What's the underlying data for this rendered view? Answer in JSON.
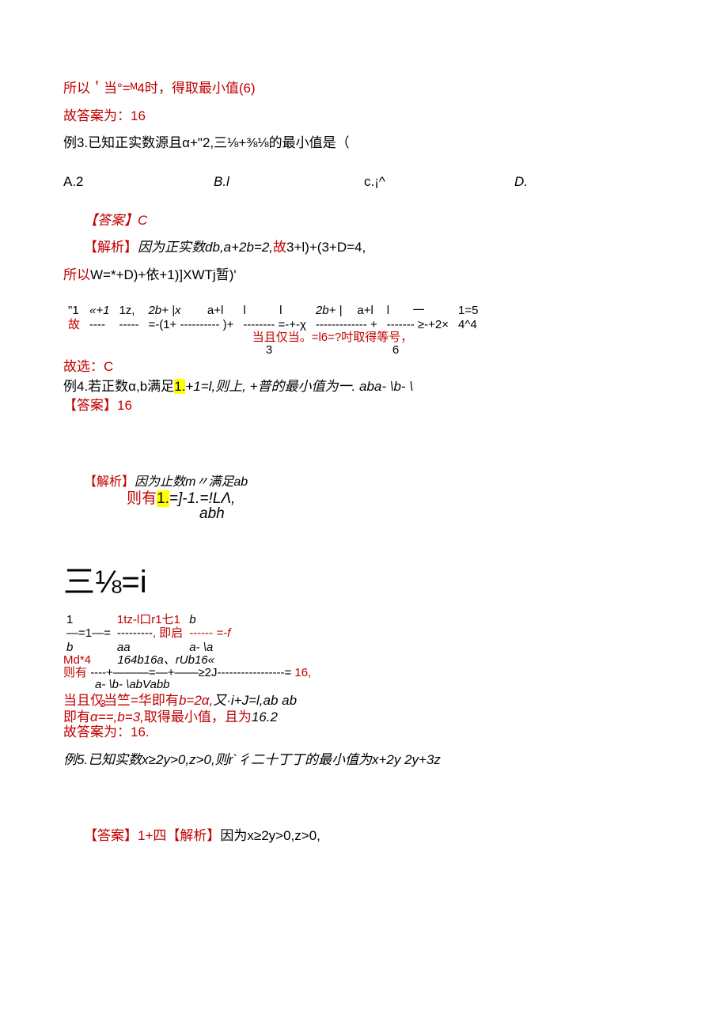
{
  "l1": "所以＇当°=ᴹ4时，得",
  "l1b": "取最小值(6)",
  "l2": "故答案为：16",
  "l3": "例3.已知正实数源且α+\"2,三⅛+⅜⅛的最小值是（",
  "choices": {
    "a": "A.2",
    "b": "B.l",
    "c": "c.¡^",
    "d": "D."
  },
  "ans1": "【答案】C",
  "jx1a": "【解析】",
  "jx1b": "因为正实数db,a+2b=2,",
  "jx1c": "故",
  "jx1d": "3+l)+(3+D=4,",
  "l4a": "所以",
  "l4b": "W=*+D)+依+1)]XWTj暂)'",
  "fr1": {
    "top": [
      "\"1",
      "«+1",
      "1z,",
      "2b+ |x",
      "a+l",
      "l",
      "l",
      "2b+ |",
      "a+l",
      "l",
      "一",
      "1=5"
    ],
    "mid": {
      "left": "故",
      "dashes": [
        "----",
        "+",
        "-----",
        "=-(1+",
        "----------",
        ")+",
        "--------",
        "=-+-χ",
        "-------------",
        "+",
        "-------",
        "≥-+2×"
      ],
      "right": "4^4"
    }
  },
  "dq1a": "当且仅当。=l6=?",
  "dq1b": "吋取得等号，",
  "dq1_l": "3",
  "dq1_r": "6",
  "l5": "故选：C",
  "l6a": "例4.若正数α,b满足",
  "l6b": "1.",
  "l6c": "+1=l,则上, +普的最小值为一. aba- \\b- \\",
  "ans2": "【答案】16",
  "jx2a": "【解析】",
  "jx2b": "因为止数m〃满足ab",
  "l7a": "则有",
  "l7b": "1.",
  "l7c": "=]-1.=!LΛ,",
  "l7d": "abh",
  "big1": "三⅛=i",
  "fr2_top": [
    "1",
    "1tz-l口r1七1",
    "b"
  ],
  "fr2_mid": [
    "—=1—=",
    "---------",
    ", 即启",
    "------",
    "=-f"
  ],
  "fr2_bot": [
    "b",
    "aa",
    "a- \\a"
  ],
  "md4a": "Md*4",
  "md4b": "164b16a、rUb16«",
  "l8a": "则有",
  "l8b": "----+———=—+——≥2J-----------------=",
  "l8c": "16,",
  "l8bot": "a- \\b- \\abVabb",
  "l9a": "当且仅当竺=华即有",
  "l9b": "b=2α,",
  "l9c": "又·i+J=l,ab        ab",
  "l10a": "即有",
  "l10b": "α==,b=3,",
  "l10c": "取得最小值，且为",
  "l10d": "16.2",
  "l10sup": "3",
  "l11": "故答案为：16.",
  "l12": "例5.已知实数x≥2y>0,z>0,则r`彳二十丁丁的最小值为x+2y         2y+3z",
  "ans3a": "【答案】1+四",
  "ans3b": "【解析】",
  "ans3c": "因为x≥2y>0,z>0,"
}
